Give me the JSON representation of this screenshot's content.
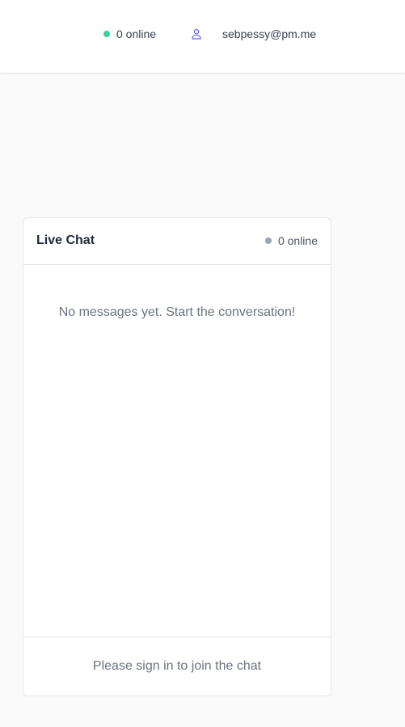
{
  "header": {
    "online_count_label": "0 online",
    "online_dot_color": "#34d399",
    "user_icon": "user-icon",
    "user_icon_color": "#6366f1",
    "user_email": "sebpessy@pm.me"
  },
  "chat": {
    "title": "Live Chat",
    "online_count_label": "0 online",
    "online_dot_color": "#9ca3af",
    "empty_message": "No messages yet. Start the conversation!",
    "footer_text": "Please sign in to join the chat"
  }
}
